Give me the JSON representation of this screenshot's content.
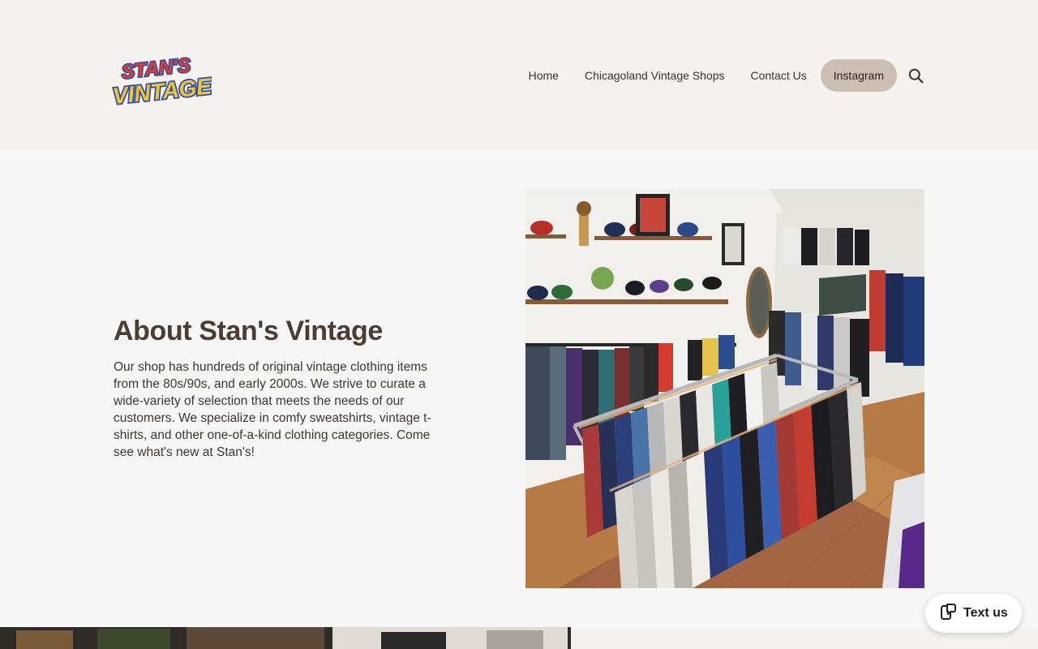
{
  "brand": {
    "logo_line1": "STAN'S",
    "logo_line2": "VINTAGE!",
    "logo_fill": "#f2c431",
    "logo_outline": "#2c4fb0",
    "logo_accent": "#e13a2b"
  },
  "nav": {
    "items": [
      {
        "label": "Home"
      },
      {
        "label": "Chicagoland Vintage Shops"
      },
      {
        "label": "Contact Us"
      }
    ],
    "cta_label": "Instagram",
    "search_icon": "search-icon"
  },
  "about": {
    "title": "About Stan's Vintage",
    "body": "Our shop has hundreds of original vintage clothing items from the 80s/90s, and early 2000s. We strive to curate a wide-variety of selection that meets the needs of our customers. We specialize in comfy sweatshirts, vintage t-shirts, and other one-of-a-kind clothing categories. Come see what's new at Stan's!"
  },
  "chat_widget": {
    "label": "Text us",
    "icon": "message-phone-icon"
  },
  "colors": {
    "header_bg": "#f5f2ef",
    "section_bg": "#f7f7f7",
    "cta_bg": "#cbbfb3",
    "heading": "#4a3d33"
  }
}
